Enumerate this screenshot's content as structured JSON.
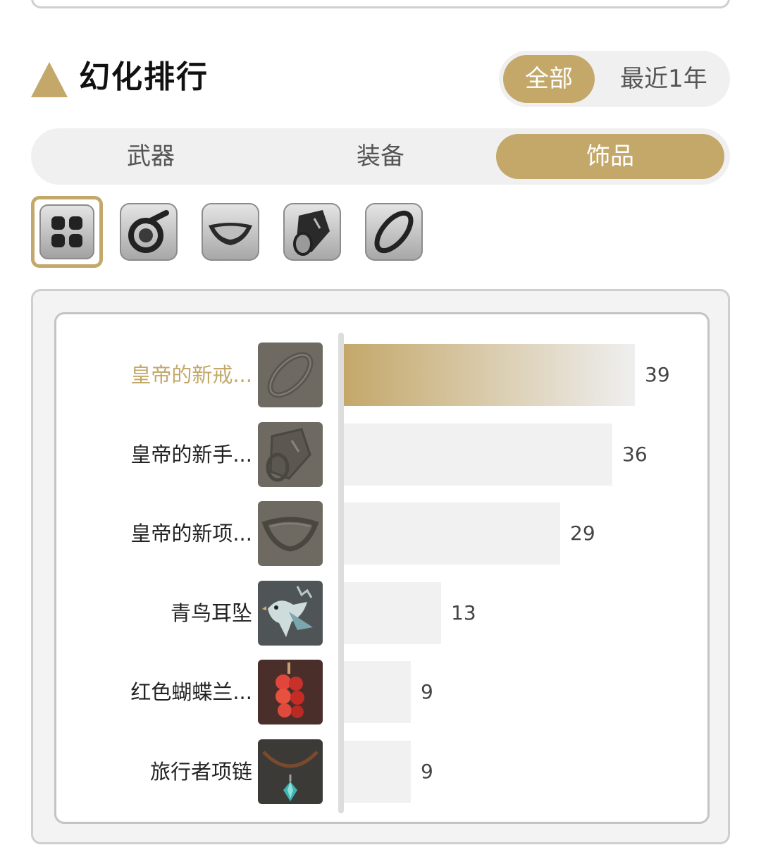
{
  "section": {
    "title": "幻化排行"
  },
  "period_toggle": {
    "options": [
      "全部",
      "最近1年"
    ],
    "selected": "全部"
  },
  "category_tabs": {
    "options": [
      "武器",
      "装备",
      "饰品"
    ],
    "selected": "饰品"
  },
  "slot_filters": [
    {
      "icon": "all-grid-icon",
      "selected": true
    },
    {
      "icon": "earring-icon",
      "selected": false
    },
    {
      "icon": "necklace-icon",
      "selected": false
    },
    {
      "icon": "bracelet-icon",
      "selected": false
    },
    {
      "icon": "ring-icon",
      "selected": false
    }
  ],
  "colors": {
    "accent": "#c4a86a",
    "tab_bg": "#f0f0f0",
    "bar": "#f1f1f1"
  },
  "chart_data": {
    "type": "bar",
    "orientation": "horizontal",
    "categories": [
      "皇帝的新戒...",
      "皇帝的新手...",
      "皇帝的新项...",
      "青鸟耳坠",
      "红色蝴蝶兰...",
      "旅行者项链"
    ],
    "values": [
      39,
      36,
      29,
      13,
      9,
      9
    ],
    "value_labels": [
      "39",
      "36",
      "29",
      "13",
      "9",
      "9"
    ],
    "item_icons": [
      "ring-icon",
      "bracelet-icon",
      "necklace-icon",
      "bluebird-earring-icon",
      "red-orchid-earring-icon",
      "traveler-necklace-icon"
    ],
    "highlighted_index": 0,
    "xlim": [
      0,
      39
    ]
  }
}
